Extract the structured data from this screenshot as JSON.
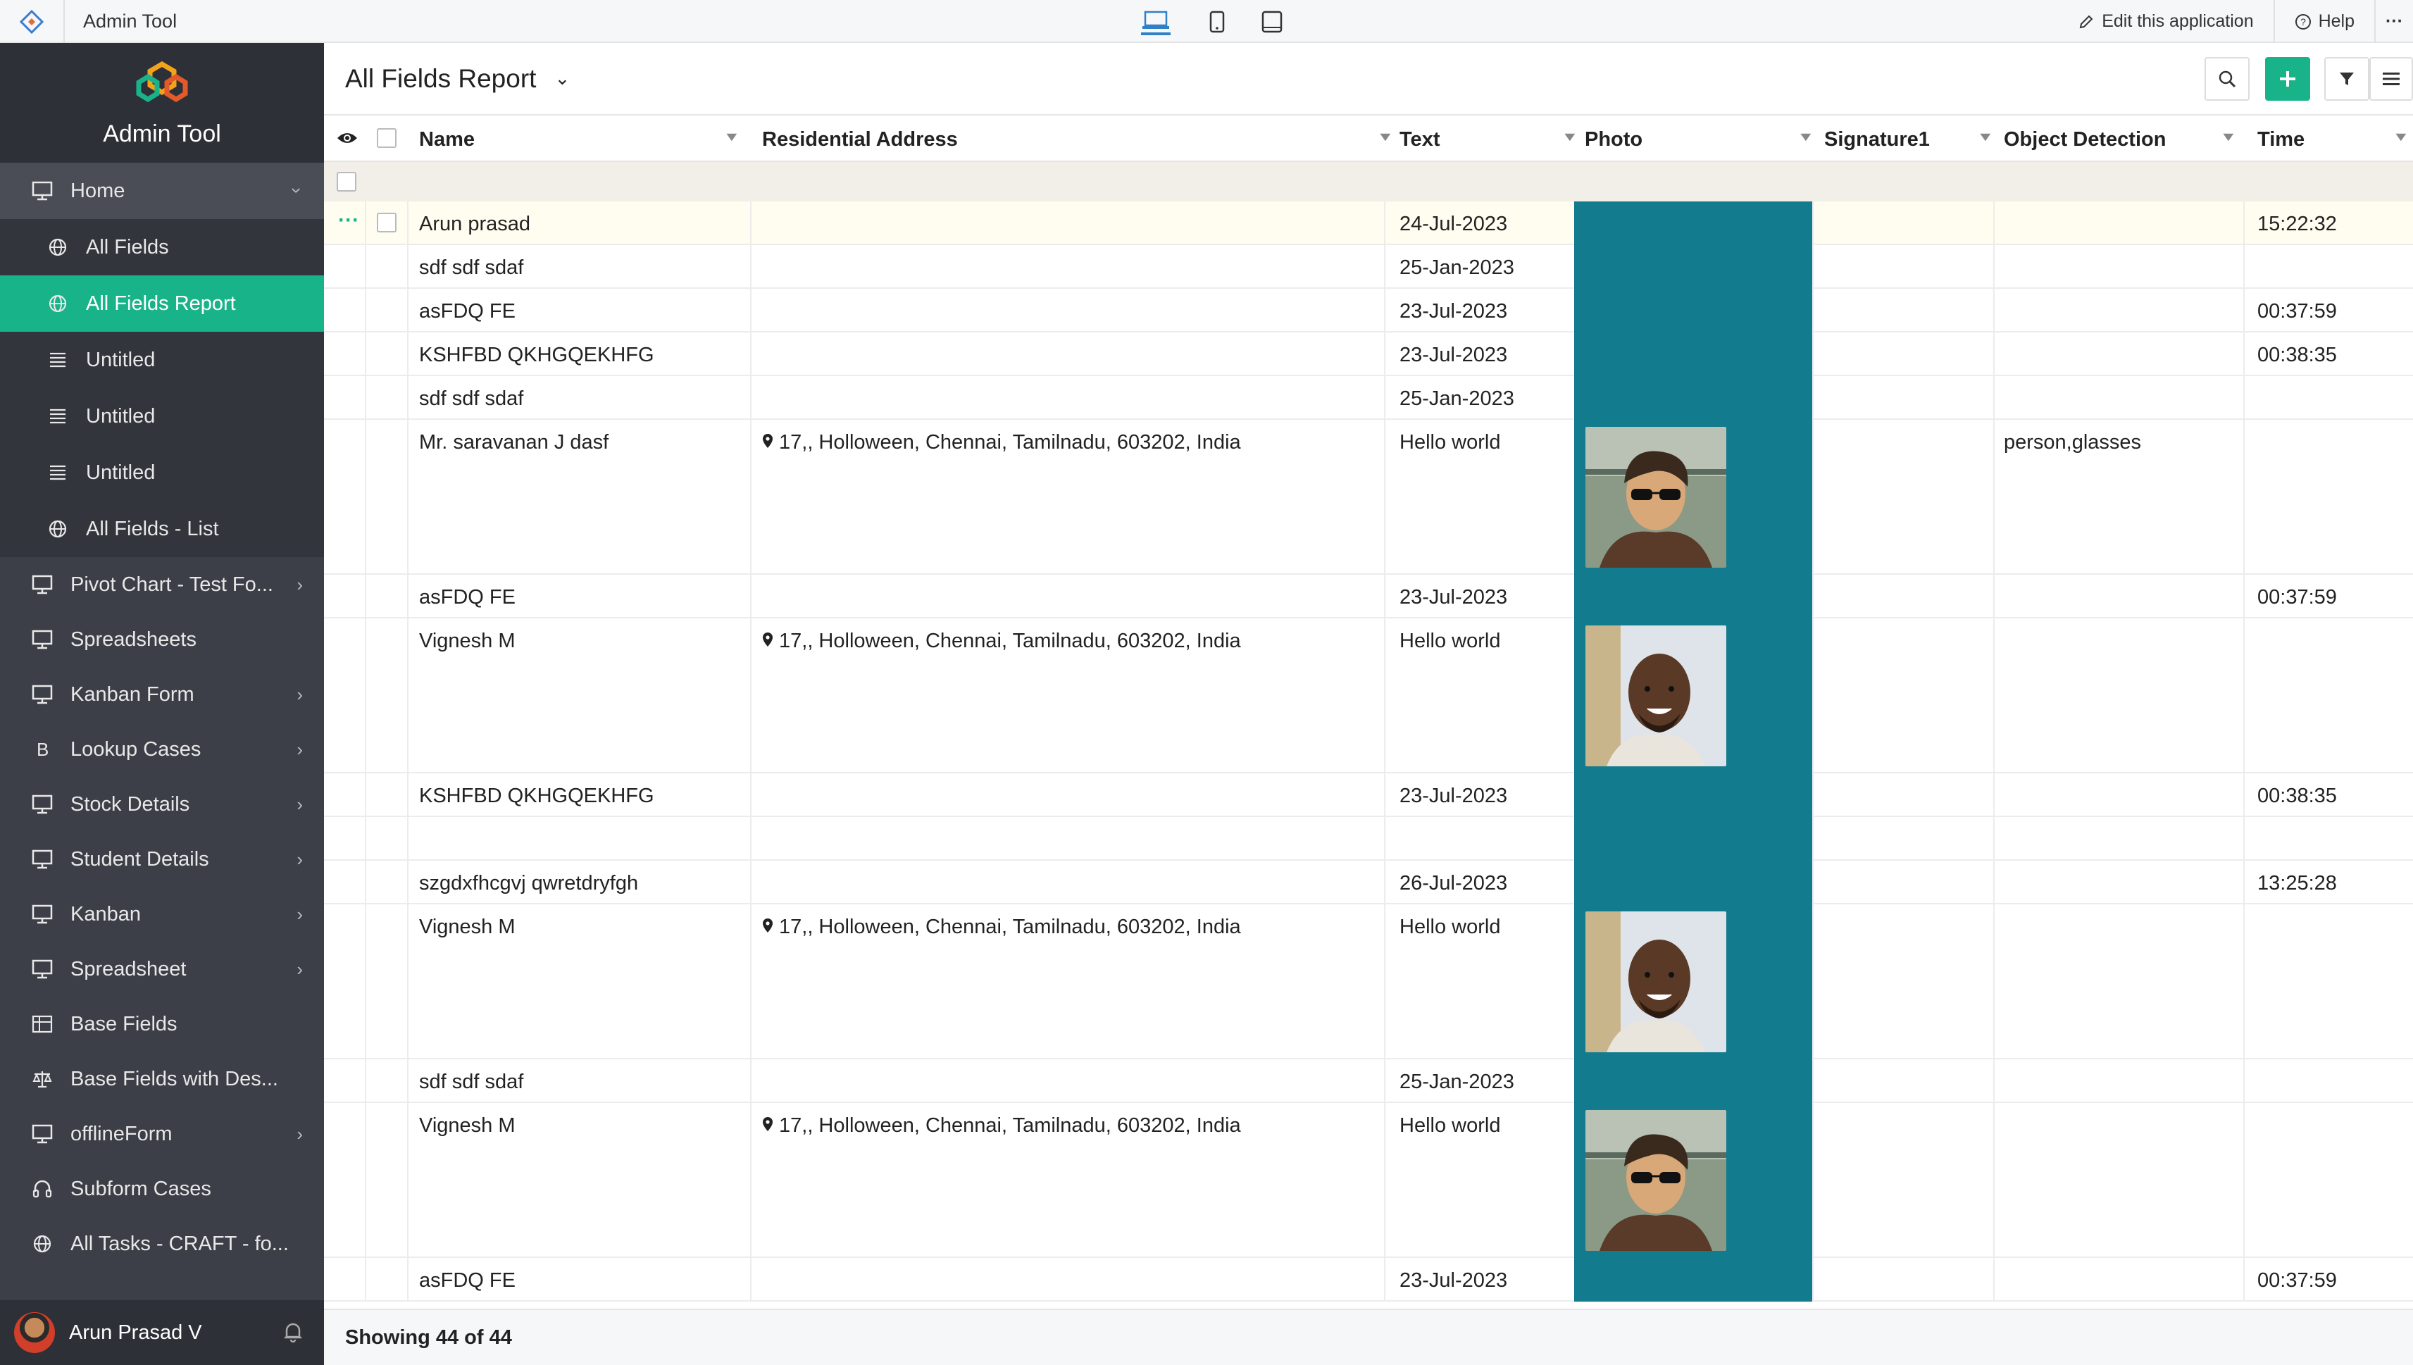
{
  "topbar": {
    "app_name": "Admin Tool",
    "edit_label": "Edit this application",
    "help_label": "Help",
    "more_label": "···"
  },
  "sidebar": {
    "brand": "Admin Tool",
    "home": "Home",
    "subitems": [
      {
        "label": "All Fields",
        "icon": "globe-icon"
      },
      {
        "label": "All Fields Report",
        "icon": "globe-icon",
        "active": true
      },
      {
        "label": "Untitled",
        "icon": "list-icon"
      },
      {
        "label": "Untitled",
        "icon": "list-icon"
      },
      {
        "label": "Untitled",
        "icon": "list-icon"
      },
      {
        "label": "All Fields - List",
        "icon": "globe-icon"
      }
    ],
    "items": [
      {
        "label": "Pivot Chart - Test Fo...",
        "icon": "monitor-icon",
        "chevron": true
      },
      {
        "label": "Spreadsheets",
        "icon": "monitor-icon",
        "chevron": false
      },
      {
        "label": "Kanban Form",
        "icon": "monitor-icon",
        "chevron": true
      },
      {
        "label": "Lookup Cases",
        "icon": "bitcoin-icon",
        "chevron": true
      },
      {
        "label": "Stock Details",
        "icon": "monitor-icon",
        "chevron": true
      },
      {
        "label": "Student Details",
        "icon": "monitor-icon",
        "chevron": true
      },
      {
        "label": "Kanban",
        "icon": "monitor-icon",
        "chevron": true
      },
      {
        "label": "Spreadsheet",
        "icon": "monitor-icon",
        "chevron": true
      },
      {
        "label": "Base Fields",
        "icon": "table-icon",
        "chevron": false
      },
      {
        "label": "Base Fields with Des...",
        "icon": "scale-icon",
        "chevron": false
      },
      {
        "label": "offlineForm",
        "icon": "monitor-icon",
        "chevron": true
      },
      {
        "label": "Subform Cases",
        "icon": "headset-icon",
        "chevron": false
      },
      {
        "label": "All Tasks - CRAFT - fo...",
        "icon": "globe-icon",
        "chevron": false
      }
    ],
    "user_name": "Arun Prasad V"
  },
  "report": {
    "title": "All Fields Report",
    "columns": [
      "Name",
      "Residential Address",
      "Text",
      "Photo",
      "Signature1",
      "Object Detection",
      "Time"
    ],
    "footer": "Showing 44 of 44"
  },
  "rows": [
    {
      "name": "Arun prasad",
      "address": "",
      "text": "24-Jul-2023",
      "photo": "",
      "obj": "",
      "time": "15:22:32",
      "highlight": true
    },
    {
      "name": "sdf sdf sdaf",
      "address": "",
      "text": "25-Jan-2023",
      "photo": "",
      "obj": "",
      "time": ""
    },
    {
      "name": "asFDQ FE",
      "address": "",
      "text": "23-Jul-2023",
      "photo": "",
      "obj": "",
      "time": "00:37:59"
    },
    {
      "name": "KSHFBD QKHGQEKHFG",
      "address": "",
      "text": "23-Jul-2023",
      "photo": "",
      "obj": "",
      "time": "00:38:35"
    },
    {
      "name": "sdf sdf sdaf",
      "address": "",
      "text": "25-Jan-2023",
      "photo": "",
      "obj": "",
      "time": ""
    },
    {
      "name": "Mr. saravanan J dasf",
      "address": "17,, Holloween, Chennai, Tamilnadu, 603202, India",
      "text": "Hello world",
      "photo": "man-sunglasses",
      "obj": "person,glasses",
      "time": ""
    },
    {
      "name": "asFDQ FE",
      "address": "",
      "text": "23-Jul-2023",
      "photo": "",
      "obj": "",
      "time": "00:37:59"
    },
    {
      "name": "Vignesh M",
      "address": "17,, Holloween, Chennai, Tamilnadu, 603202, India",
      "text": "Hello world",
      "photo": "man-smiling",
      "obj": "",
      "time": ""
    },
    {
      "name": "KSHFBD QKHGQEKHFG",
      "address": "",
      "text": "23-Jul-2023",
      "photo": "",
      "obj": "",
      "time": "00:38:35"
    },
    {
      "name": "",
      "address": "",
      "text": "",
      "photo": "",
      "obj": "",
      "time": ""
    },
    {
      "name": "szgdxfhcgvj qwretdryfgh",
      "address": "",
      "text": "26-Jul-2023",
      "photo": "",
      "obj": "",
      "time": "13:25:28"
    },
    {
      "name": "Vignesh M",
      "address": "17,, Holloween, Chennai, Tamilnadu, 603202, India",
      "text": "Hello world",
      "photo": "man-smiling",
      "obj": "",
      "time": ""
    },
    {
      "name": "sdf sdf sdaf",
      "address": "",
      "text": "25-Jan-2023",
      "photo": "",
      "obj": "",
      "time": ""
    },
    {
      "name": "Vignesh M",
      "address": "17,, Holloween, Chennai, Tamilnadu, 603202, India",
      "text": "Hello world",
      "photo": "man-sunglasses",
      "obj": "",
      "time": ""
    },
    {
      "name": "asFDQ FE",
      "address": "",
      "text": "23-Jul-2023",
      "photo": "",
      "obj": "",
      "time": "00:37:59"
    }
  ],
  "colors": {
    "accent": "#19b38a",
    "photo_bg": "#127b8d",
    "sidebar": "#3c3f47"
  }
}
